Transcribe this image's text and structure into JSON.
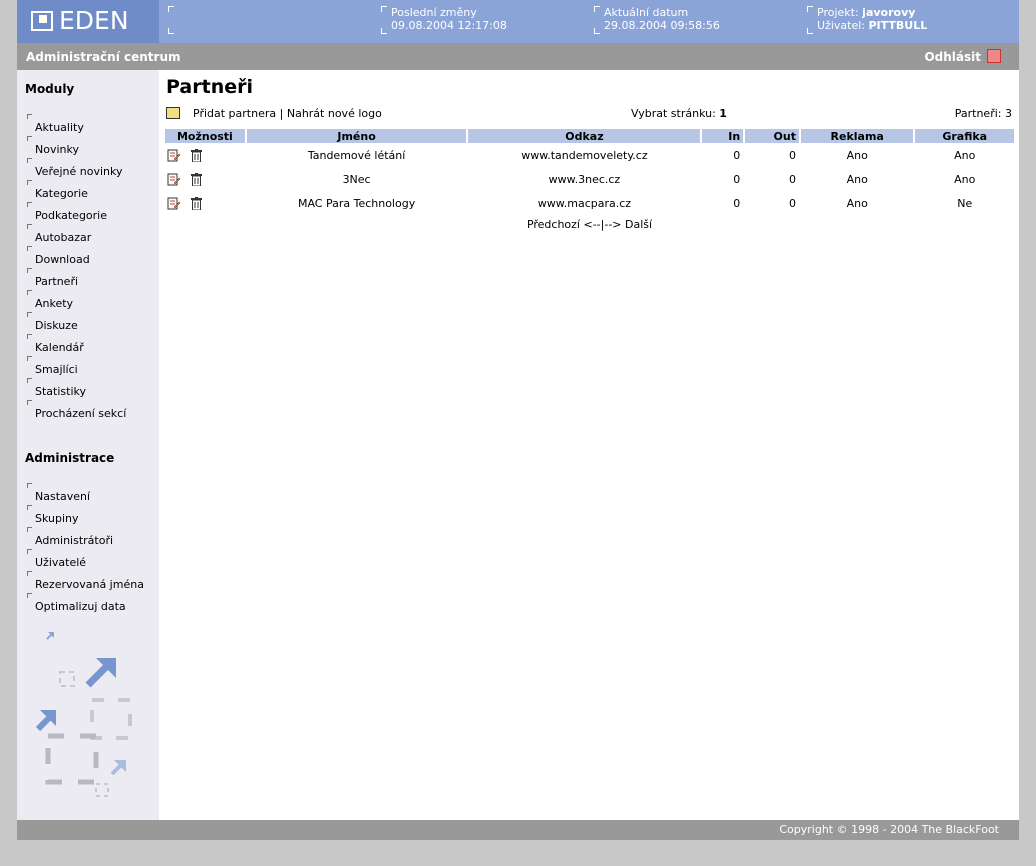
{
  "header": {
    "logo_text": "EDEN",
    "last_changes_label": "Poslední změny",
    "last_changes_value": "09.08.2004 12:17:08",
    "current_date_label": "Aktuální datum",
    "current_date_value": "29.08.2004 09:58:56",
    "project_label": "Projekt:",
    "project_value": "javorovy",
    "user_label": "Uživatel:",
    "user_value": "PITTBULL"
  },
  "graybar": {
    "title": "Administrační centrum",
    "logout_label": "Odhlásit"
  },
  "sidebar": {
    "modules_heading": "Moduly",
    "modules": [
      "Aktuality",
      "Novinky",
      "Veřejné novinky",
      "Kategorie",
      "Podkategorie",
      "Autobazar",
      "Download",
      "Partneři",
      "Ankety",
      "Diskuze",
      "Kalendář",
      "Smajlíci",
      "Statistiky",
      "Procházení sekcí"
    ],
    "admin_heading": "Administrace",
    "admin": [
      "Nastavení",
      "Skupiny",
      "Administrátoři",
      "Uživatelé",
      "Rezervovaná jména",
      "Optimalizuj data"
    ]
  },
  "main": {
    "title": "Partneři",
    "add_partner": "Přidat partnera",
    "separator": "|",
    "upload_logo": "Nahrát nové logo",
    "page_select_label": "Vybrat stránku:",
    "page_select_value": "1",
    "partners_count_label": "Partneři:",
    "partners_count_value": "3",
    "columns": [
      "Možnosti",
      "Jméno",
      "Odkaz",
      "In",
      "Out",
      "Reklama",
      "Grafika"
    ],
    "rows": [
      {
        "name": "Tandemové létání",
        "link": "www.tandemovelety.cz",
        "in": "0",
        "out": "0",
        "ad": "Ano",
        "graphic": "Ano"
      },
      {
        "name": "3Nec",
        "link": "www.3nec.cz",
        "in": "0",
        "out": "0",
        "ad": "Ano",
        "graphic": "Ano"
      },
      {
        "name": "MAC Para Technology",
        "link": "www.macpara.cz",
        "in": "0",
        "out": "0",
        "ad": "Ano",
        "graphic": "Ne"
      }
    ],
    "pager": "Předchozí <--|--> Další"
  },
  "footer": {
    "copyright": "Copyright © 1998 - 2004 The BlackFoot"
  },
  "colors": {
    "topbar": "#8aa4d8",
    "logo_bg": "#6f8cc8",
    "graybar": "#999999",
    "sidebar_bg": "#ecebf2",
    "table_header": "#b6c6e4"
  }
}
